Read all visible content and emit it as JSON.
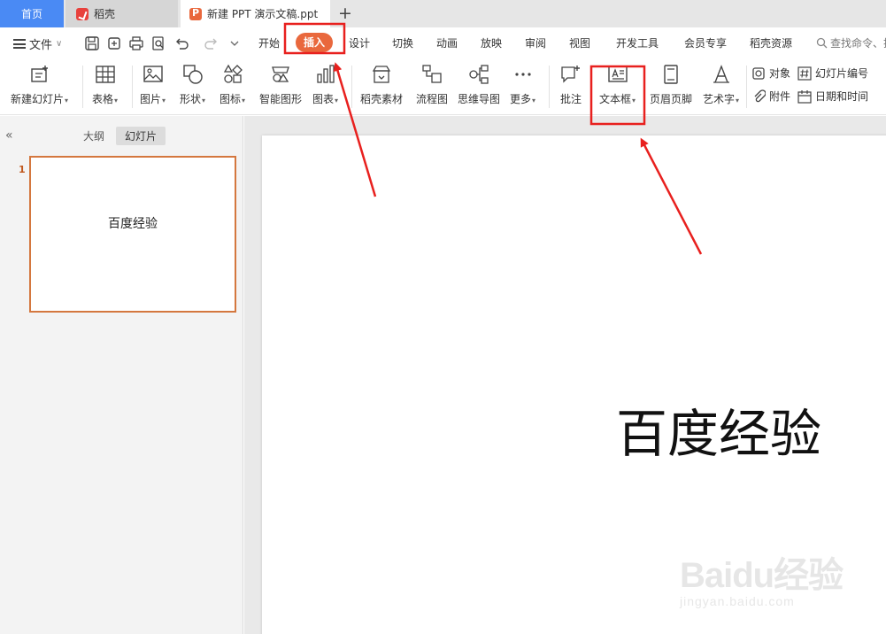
{
  "tabs": {
    "home": "首页",
    "daoke": "稻壳",
    "document": "新建 PPT 演示文稿.ppt",
    "add": "+"
  },
  "menu": {
    "file": "文件",
    "file_caret": "∨",
    "tabs": [
      "开始",
      "插入",
      "设计",
      "切换",
      "动画",
      "放映",
      "审阅",
      "视图",
      "开发工具",
      "会员专享",
      "稻壳资源"
    ],
    "active_tab": "插入",
    "search_placeholder": "查找命令、搜"
  },
  "ribbon": {
    "new_slide": "新建幻灯片",
    "table": "表格",
    "picture": "图片",
    "shape": "形状",
    "icon": "图标",
    "smart_art": "智能图形",
    "chart": "图表",
    "daoke_material": "稻壳素材",
    "flowchart": "流程图",
    "mind_map": "思维导图",
    "more": "更多",
    "comment": "批注",
    "textbox": "文本框",
    "header_footer": "页眉页脚",
    "word_art": "艺术字",
    "object": "对象",
    "attachment": "附件",
    "slide_number": "幻灯片编号",
    "date_time": "日期和时间",
    "caret": "▾"
  },
  "panel": {
    "collapse": "«",
    "outline_tab": "大纲",
    "slides_tab": "幻灯片",
    "slide_number": "1",
    "thumb_text": "百度经验"
  },
  "slide": {
    "text": "百度经验"
  },
  "watermark": {
    "main": "Baidu经验",
    "sub": "jingyan.baidu.com"
  },
  "colors": {
    "accent_orange": "#e9683d",
    "home_tab_blue": "#4a8af4",
    "annotation_red": "#e8201e"
  }
}
